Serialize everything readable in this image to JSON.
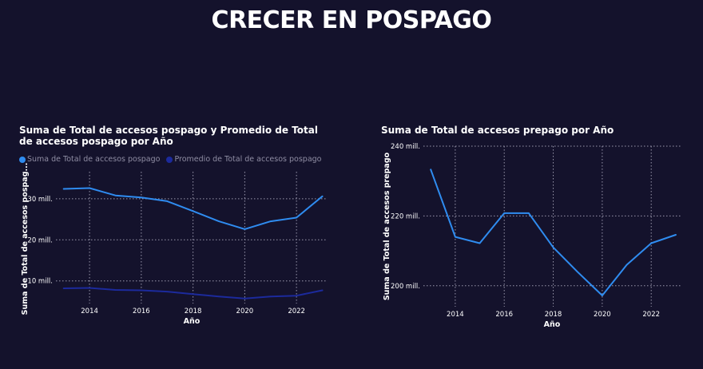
{
  "page": {
    "title": "CRECER EN POSPAGO"
  },
  "colors": {
    "background": "#14122c",
    "series_light": "#2f8cf0",
    "series_dark": "#1c2a9c",
    "grid": "#9a98ad"
  },
  "chart_data": [
    {
      "type": "line",
      "title": "Suma de Total de accesos pospago y Promedio de Total de accesos pospago por Año",
      "xlabel": "Año",
      "ylabel": "Suma de Total de accesos pospag...",
      "x": [
        2013,
        2014,
        2015,
        2016,
        2017,
        2018,
        2019,
        2020,
        2021,
        2022,
        2023
      ],
      "x_ticks": [
        "2014",
        "2016",
        "2018",
        "2020",
        "2022"
      ],
      "x_tick_values": [
        2014,
        2016,
        2018,
        2020,
        2022
      ],
      "y_ticks": [
        "10 mill.",
        "20 mill.",
        "30 mill."
      ],
      "y_tick_values": [
        10,
        20,
        30
      ],
      "ylim": [
        4.5,
        36
      ],
      "xlim": [
        2012.7,
        2023.2
      ],
      "legend": "top-left",
      "series": [
        {
          "name": "Suma de Total de accesos pospago",
          "color": "#2f8cf0",
          "values": [
            32.4,
            32.6,
            30.8,
            30.3,
            29.4,
            27.0,
            24.5,
            22.6,
            24.5,
            25.4,
            30.6
          ]
        },
        {
          "name": "Promedio de Total de accesos pospago",
          "color": "#1c2a9c",
          "values": [
            8.2,
            8.3,
            7.8,
            7.7,
            7.4,
            6.8,
            6.2,
            5.7,
            6.2,
            6.4,
            7.7
          ]
        }
      ]
    },
    {
      "type": "line",
      "title": "Suma de Total de accesos prepago por Año",
      "xlabel": "Año",
      "ylabel": "Suma de Total de accesos prepago",
      "x": [
        2013,
        2014,
        2015,
        2016,
        2017,
        2018,
        2019,
        2020,
        2021,
        2022,
        2023
      ],
      "x_ticks": [
        "2014",
        "2016",
        "2018",
        "2020",
        "2022"
      ],
      "x_tick_values": [
        2014,
        2016,
        2018,
        2020,
        2022
      ],
      "y_ticks": [
        "200 mill.",
        "220 mill.",
        "240 mill."
      ],
      "y_tick_values": [
        200,
        220,
        240
      ],
      "ylim": [
        194,
        240
      ],
      "xlim": [
        2012.7,
        2023.2
      ],
      "series": [
        {
          "name": "Suma de Total de accesos prepago",
          "color": "#2f8cf0",
          "values": [
            233.3,
            214.0,
            212.2,
            220.8,
            220.8,
            211.0,
            203.9,
            197.2,
            206.0,
            212.2,
            214.6
          ]
        }
      ]
    }
  ]
}
